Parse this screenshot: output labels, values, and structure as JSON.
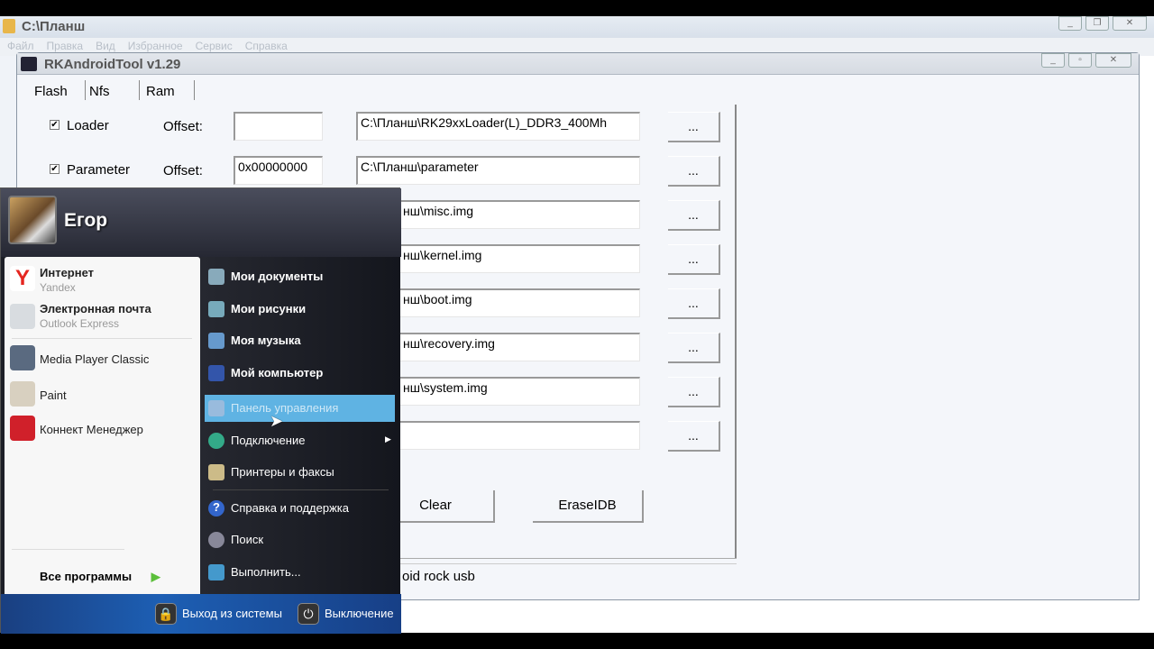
{
  "explorer": {
    "title": "C:\\Планш",
    "menu": [
      "Файл",
      "Правка",
      "Вид",
      "Избранное",
      "Сервис",
      "Справка"
    ]
  },
  "rk": {
    "title": "RKAndroidTool v1.29",
    "tabs": [
      "Flash",
      "Nfs",
      "Ram"
    ],
    "rows": [
      {
        "checked": true,
        "label": "Loader",
        "offset_label": "Offset:",
        "offset": "",
        "path": "C:\\Планш\\RK29xxLoader(L)_DDR3_400Mh"
      },
      {
        "checked": true,
        "label": "Parameter",
        "offset_label": "Offset:",
        "offset": "0x00000000",
        "path": "C:\\Планш\\parameter"
      },
      {
        "path": "нш\\misc.img"
      },
      {
        "path": "нш\\kernel.img"
      },
      {
        "path": "нш\\boot.img"
      },
      {
        "path": "нш\\recovery.img"
      },
      {
        "path": "нш\\system.img"
      },
      {
        "path": ""
      }
    ],
    "browse_label": "...",
    "clear_label": "Clear",
    "erase_label": "EraseIDB",
    "status": "oid rock usb"
  },
  "start_menu": {
    "user": "Егор",
    "pinned": [
      {
        "title": "Интернет",
        "subtitle": "Yandex",
        "icon": "yandex-browser-icon",
        "color": "#e52620"
      },
      {
        "title": "Электронная почта",
        "subtitle": "Outlook Express",
        "icon": "mail-envelope-icon",
        "color": "#c8ccd0"
      }
    ],
    "recent": [
      {
        "title": "Media Player Classic",
        "icon": "media-player-icon",
        "color": "#5a6a80"
      },
      {
        "title": "Paint",
        "icon": "paint-icon",
        "color": "#d8d0c0"
      },
      {
        "title": "Коннект Менеджер",
        "icon": "connect-manager-icon",
        "color": "#d0202a"
      }
    ],
    "all_programs": "Все программы",
    "places": [
      {
        "label": "Мои документы",
        "bold": true,
        "icon": "documents-icon"
      },
      {
        "label": "Мои рисунки",
        "bold": true,
        "icon": "pictures-icon"
      },
      {
        "label": "Моя музыка",
        "bold": true,
        "icon": "music-icon"
      },
      {
        "label": "Мой компьютер",
        "bold": true,
        "icon": "computer-icon"
      },
      {
        "label": "Панель управления",
        "highlighted": true,
        "icon": "control-panel-icon"
      },
      {
        "label": "Подключение",
        "submenu": true,
        "icon": "network-icon"
      },
      {
        "label": "Принтеры и факсы",
        "icon": "printer-icon"
      },
      {
        "label": "Справка и поддержка",
        "icon": "help-icon"
      },
      {
        "label": "Поиск",
        "icon": "search-icon"
      },
      {
        "label": "Выполнить...",
        "icon": "run-icon"
      }
    ],
    "logoff": "Выход из системы",
    "shutdown": "Выключение"
  }
}
